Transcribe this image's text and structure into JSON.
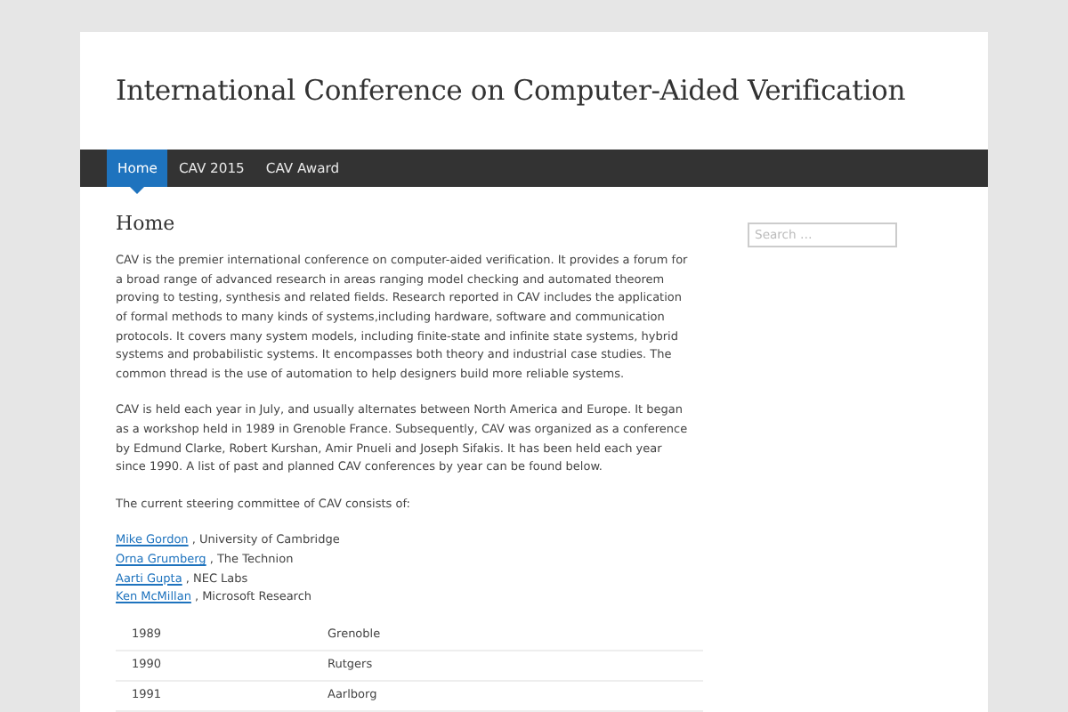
{
  "site_title": "International Conference on Computer-Aided Verification",
  "nav": [
    {
      "label": "Home",
      "selected": true
    },
    {
      "label": "CAV 2015",
      "selected": false
    },
    {
      "label": "CAV Award",
      "selected": false
    }
  ],
  "page_title": "Home",
  "paragraphs": [
    "CAV is the premier international conference on computer-aided verification. It provides a forum for a broad range of advanced research in areas ranging model checking and automated theorem proving to testing, synthesis and related fields. Research reported in CAV includes the application of formal methods to many kinds of systems,including hardware, software and communication protocols. It covers many system models, including finite-state and infinite state systems, hybrid systems and probabilistic systems. It encompasses both theory and industrial case studies. The common thread is the use of automation to help designers build more reliable systems.",
    "CAV is held each year in July, and usually alternates between North America and Europe. It began as a workshop held in 1989 in Grenoble France. Subsequently, CAV was organized as a conference by Edmund Clarke, Robert Kurshan, Amir Pnueli and Joseph Sifakis. It has been held each year since 1990. A list of past and planned CAV conferences by year can be found below.",
    "The current steering committee of CAV consists of:"
  ],
  "committee": [
    {
      "name": "Mike Gordon",
      "affiliation": ", University of Cambridge"
    },
    {
      "name": "Orna Grumberg",
      "affiliation": ", The Technion"
    },
    {
      "name": "Aarti Gupta",
      "affiliation": ", NEC Labs"
    },
    {
      "name": "Ken McMillan",
      "affiliation": ", Microsoft Research"
    }
  ],
  "conferences": [
    [
      "1989",
      "Grenoble"
    ],
    [
      "1990",
      "Rutgers"
    ],
    [
      "1991",
      "Aarlborg"
    ]
  ],
  "search": {
    "placeholder": "Search …"
  }
}
